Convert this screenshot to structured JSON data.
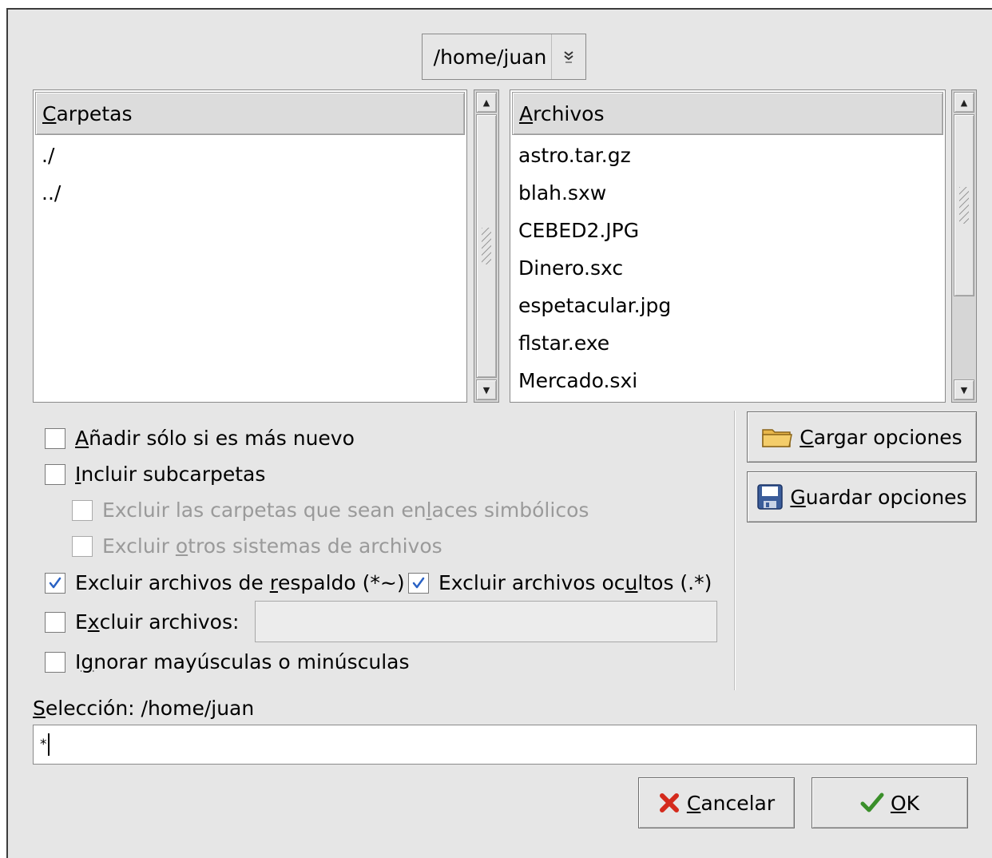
{
  "path_combo": {
    "value": "/home/juan"
  },
  "folders": {
    "header": "Carpetas",
    "header_mnemonic": "C",
    "items": [
      "./",
      "../"
    ]
  },
  "files": {
    "header": "Archivos",
    "header_mnemonic": "A",
    "items": [
      "astro.tar.gz",
      "blah.sxw",
      "CEBED2.JPG",
      "Dinero.sxc",
      "espetacular.jpg",
      "flstar.exe",
      "Mercado.sxi"
    ]
  },
  "options": {
    "only_newer": {
      "mn": "A",
      "rest": "ñadir sólo si es más nuevo",
      "checked": false
    },
    "include_subfolders": {
      "mn": "I",
      "rest": "ncluir subcarpetas",
      "checked": false
    },
    "exclude_symlinks": {
      "pre": "Excluir las carpetas que sean en",
      "mn": "l",
      "post": "aces simbólicos",
      "checked": false,
      "enabled": false
    },
    "exclude_other_fs": {
      "pre": "Excluir ",
      "mn": "o",
      "post": "tros sistemas de archivos",
      "checked": false,
      "enabled": false
    },
    "exclude_backup": {
      "pre": "Excluir archivos de ",
      "mn": "r",
      "post": "espaldo (*~)",
      "checked": true
    },
    "exclude_hidden": {
      "pre": "Excluir archivos oc",
      "mn": "u",
      "post": "ltos (.*)",
      "checked": true
    },
    "exclude_files": {
      "pre": "E",
      "mn": "x",
      "post": "cluir archivos:",
      "checked": false,
      "value": ""
    },
    "ignore_case": {
      "pre": "I",
      "mn": "g",
      "post": "norar mayúsculas o minúsculas",
      "checked": false
    }
  },
  "side_buttons": {
    "load": {
      "mn": "C",
      "rest": "argar opciones",
      "icon": "folder-icon"
    },
    "save": {
      "mn": "G",
      "rest": "uardar opciones",
      "icon": "floppy-disk-icon"
    }
  },
  "selection": {
    "label_mn": "S",
    "label_rest": "elección: /home/juan",
    "value": "*"
  },
  "buttons": {
    "cancel": {
      "mn": "C",
      "rest": "ancelar",
      "icon": "red-x-icon"
    },
    "ok": {
      "mn": "O",
      "rest": "K",
      "icon": "green-check-icon"
    }
  },
  "colors": {
    "check_blue": "#2a62c4",
    "dialog_bg": "#e6e6e6"
  }
}
